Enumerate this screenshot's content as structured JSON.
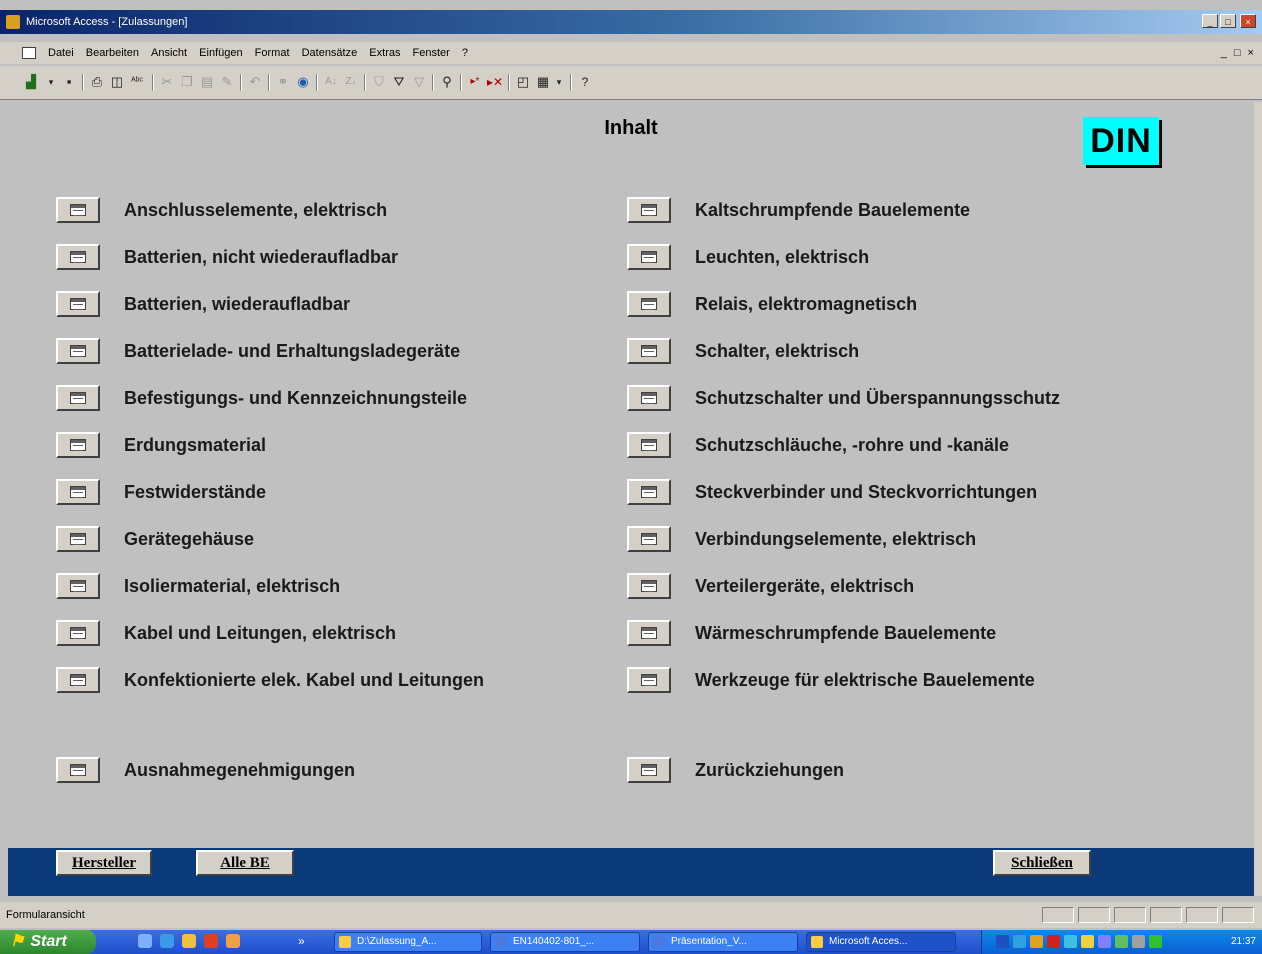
{
  "window": {
    "title": "Microsoft Access - [Zulassungen]",
    "controls": [
      "_",
      "□",
      "×"
    ]
  },
  "menu": {
    "items": [
      "Datei",
      "Bearbeiten",
      "Ansicht",
      "Einfügen",
      "Format",
      "Datensätze",
      "Extras",
      "Fenster",
      "?"
    ],
    "mdi_controls": "_ □ ×"
  },
  "toolbar": {
    "icons": [
      "design-view-icon",
      "save-icon",
      "print-icon",
      "print-preview-icon",
      "spelling-icon",
      "cut-icon",
      "copy-icon",
      "paste-icon",
      "format-painter-icon",
      "undo-icon",
      "insert-hyperlink-icon",
      "web-toolbar-icon",
      "sort-ascending-icon",
      "sort-descending-icon",
      "filter-by-selection-icon",
      "filter-by-form-icon",
      "apply-filter-icon",
      "find-icon",
      "new-record-icon",
      "delete-record-icon",
      "database-window-icon",
      "new-object-icon",
      "help-icon"
    ]
  },
  "form": {
    "title": "Inhalt",
    "logo_text": "DIN",
    "logo_color": "#00ffff",
    "left_items": [
      "Anschlusselemente, elektrisch",
      "Batterien, nicht wiederaufladbar",
      "Batterien, wiederaufladbar",
      "Batterielade- und Erhaltungsladegeräte",
      "Befestigungs- und Kennzeichnungsteile",
      "Erdungsmaterial",
      "Festwiderstände",
      "Gerätegehäuse",
      "Isoliermaterial, elektrisch",
      "Kabel und Leitungen, elektrisch",
      "Konfektionierte elek. Kabel und Leitungen"
    ],
    "right_items": [
      "Kaltschrumpfende Bauelemente",
      "Leuchten, elektrisch",
      "Relais, elektromagnetisch",
      "Schalter, elektrisch",
      "Schutzschalter und Überspannungsschutz",
      "Schutzschläuche, -rohre und -kanäle",
      "Steckverbinder und Steckvorrichtungen",
      "Verbindungselemente, elektrisch",
      "Verteilergeräte, elektrisch",
      "Wärmeschrumpfende Bauelemente",
      "Werkzeuge für elektrische Bauelemente"
    ],
    "extra_left": "Ausnahmegenehmigungen",
    "extra_right": "Zurückziehungen"
  },
  "bottom_bar": {
    "hersteller": "Hersteller",
    "alle_be": "Alle BE",
    "schliessen": "Schließen",
    "color": "#0a3a7a"
  },
  "status": {
    "text": "Formularansicht"
  },
  "taskbar": {
    "start": "Start",
    "more": "»",
    "tasks": [
      "D:\\Zulassung_A...",
      "EN140402-801_...",
      "Präsentation_V...",
      "Microsoft Acces..."
    ],
    "clock": "21:37"
  }
}
